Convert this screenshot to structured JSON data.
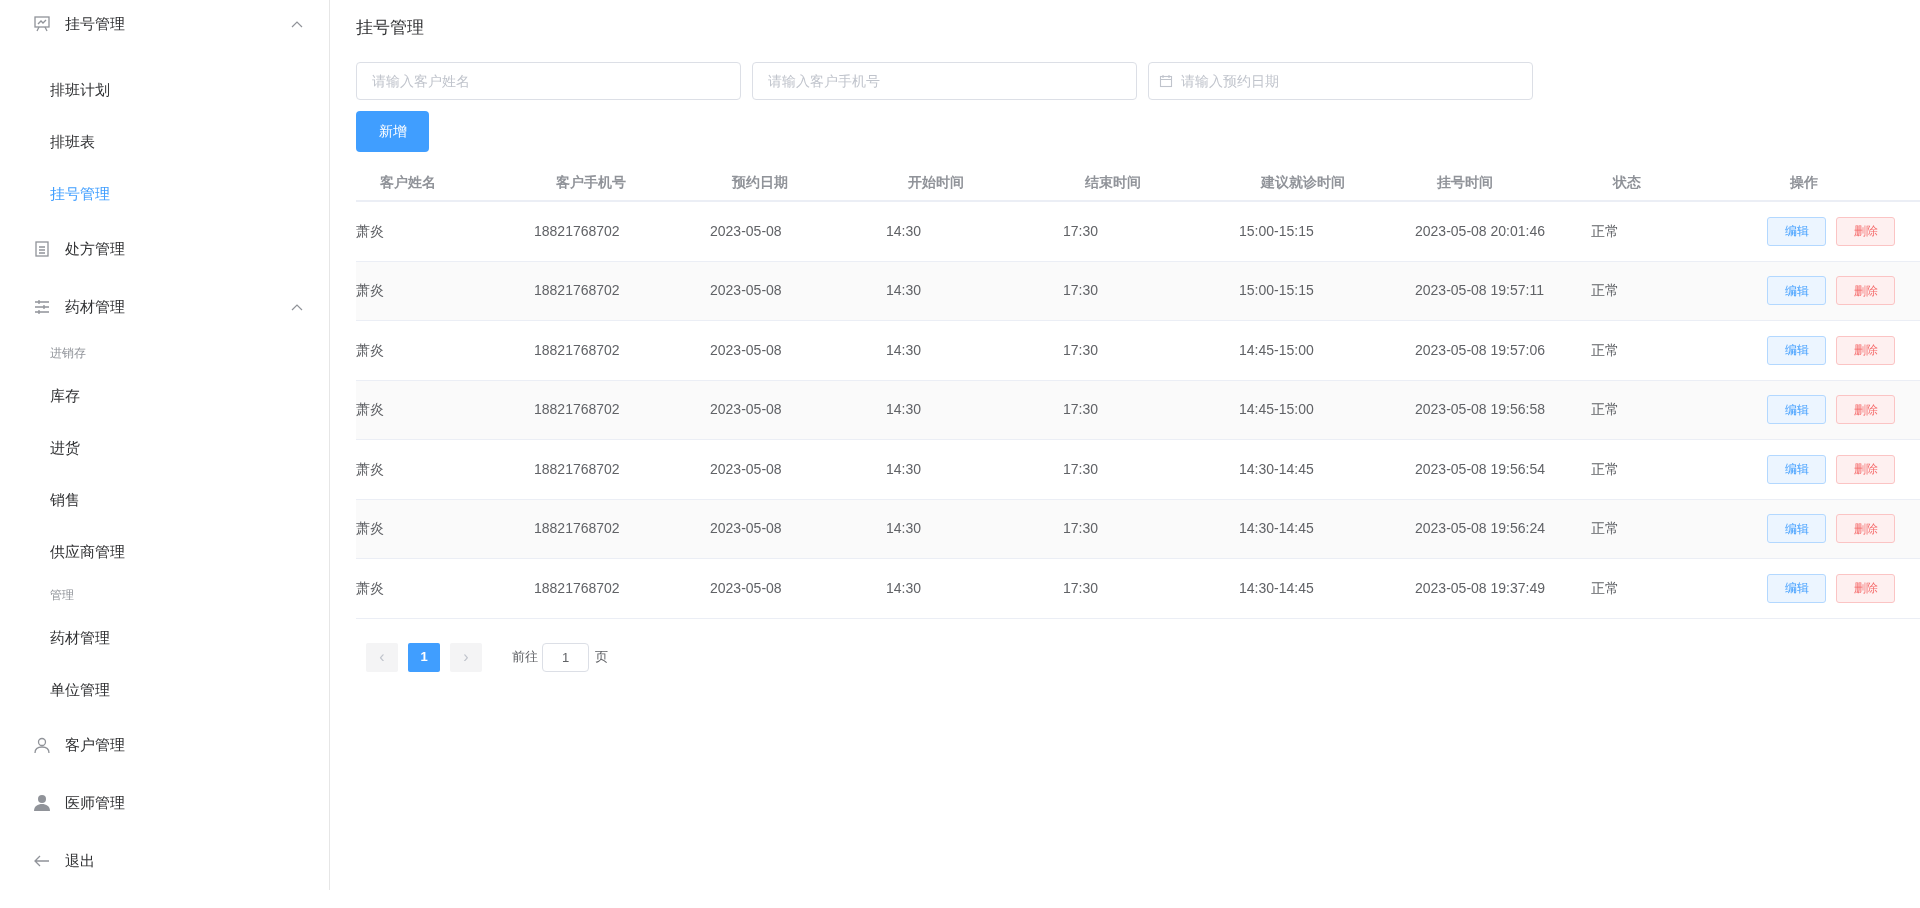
{
  "sidebar": {
    "items": [
      {
        "kind": "menu",
        "label": "挂号管理",
        "expanded": true,
        "children": [
          {
            "kind": "item",
            "label": "排班计划",
            "selected": false
          },
          {
            "kind": "item",
            "label": "排班表",
            "selected": false
          },
          {
            "kind": "item",
            "label": "挂号管理",
            "selected": true
          }
        ]
      },
      {
        "kind": "link",
        "label": "处方管理"
      },
      {
        "kind": "menu",
        "label": "药材管理",
        "expanded": true,
        "children": [
          {
            "kind": "group",
            "label": "进销存"
          },
          {
            "kind": "item",
            "label": "库存",
            "selected": false
          },
          {
            "kind": "item",
            "label": "进货",
            "selected": false
          },
          {
            "kind": "item",
            "label": "销售",
            "selected": false
          },
          {
            "kind": "item",
            "label": "供应商管理",
            "selected": false
          },
          {
            "kind": "group",
            "label": "管理"
          },
          {
            "kind": "item",
            "label": "药材管理",
            "selected": false
          },
          {
            "kind": "item",
            "label": "单位管理",
            "selected": false
          }
        ]
      },
      {
        "kind": "link",
        "label": "客户管理"
      },
      {
        "kind": "link",
        "label": "医师管理"
      },
      {
        "kind": "link",
        "label": "退出"
      }
    ]
  },
  "page_title": "挂号管理",
  "filters": [
    {
      "kind": "text",
      "placeholder": "请输入客户姓名"
    },
    {
      "kind": "text",
      "placeholder": "请输入客户手机号"
    },
    {
      "kind": "date",
      "placeholder": "请输入预约日期"
    }
  ],
  "add_button": "新增",
  "table": {
    "columns": [
      "客户姓名",
      "客户手机号",
      "预约日期",
      "开始时间",
      "结束时间",
      "建议就诊时间",
      "挂号时间",
      "状态",
      "操作"
    ],
    "rows": [
      {
        "cells": [
          "萧炎",
          "18821768702",
          "2023-05-08",
          "14:30",
          "17:30",
          "15:00-15:15",
          "2023-05-08 20:01:46",
          "正常"
        ],
        "actions": [
          "编辑",
          "删除"
        ]
      },
      {
        "cells": [
          "萧炎",
          "18821768702",
          "2023-05-08",
          "14:30",
          "17:30",
          "15:00-15:15",
          "2023-05-08 19:57:11",
          "正常"
        ],
        "actions": [
          "编辑",
          "删除"
        ]
      },
      {
        "cells": [
          "萧炎",
          "18821768702",
          "2023-05-08",
          "14:30",
          "17:30",
          "14:45-15:00",
          "2023-05-08 19:57:06",
          "正常"
        ],
        "actions": [
          "编辑",
          "删除"
        ]
      },
      {
        "cells": [
          "萧炎",
          "18821768702",
          "2023-05-08",
          "14:30",
          "17:30",
          "14:45-15:00",
          "2023-05-08 19:56:58",
          "正常"
        ],
        "actions": [
          "编辑",
          "删除"
        ]
      },
      {
        "cells": [
          "萧炎",
          "18821768702",
          "2023-05-08",
          "14:30",
          "17:30",
          "14:30-14:45",
          "2023-05-08 19:56:54",
          "正常"
        ],
        "actions": [
          "编辑",
          "删除"
        ]
      },
      {
        "cells": [
          "萧炎",
          "18821768702",
          "2023-05-08",
          "14:30",
          "17:30",
          "14:30-14:45",
          "2023-05-08 19:56:24",
          "正常"
        ],
        "actions": [
          "编辑",
          "删除"
        ]
      },
      {
        "cells": [
          "萧炎",
          "18821768702",
          "2023-05-08",
          "14:30",
          "17:30",
          "14:30-14:45",
          "2023-05-08 19:37:49",
          "正常"
        ],
        "actions": [
          "编辑",
          "删除"
        ]
      }
    ]
  },
  "pagination": {
    "prev": "‹",
    "pages": [
      {
        "label": "1",
        "selected": true
      }
    ],
    "next": "›",
    "goto_label": "前往",
    "goto_value": "1",
    "page_suffix": "页"
  }
}
